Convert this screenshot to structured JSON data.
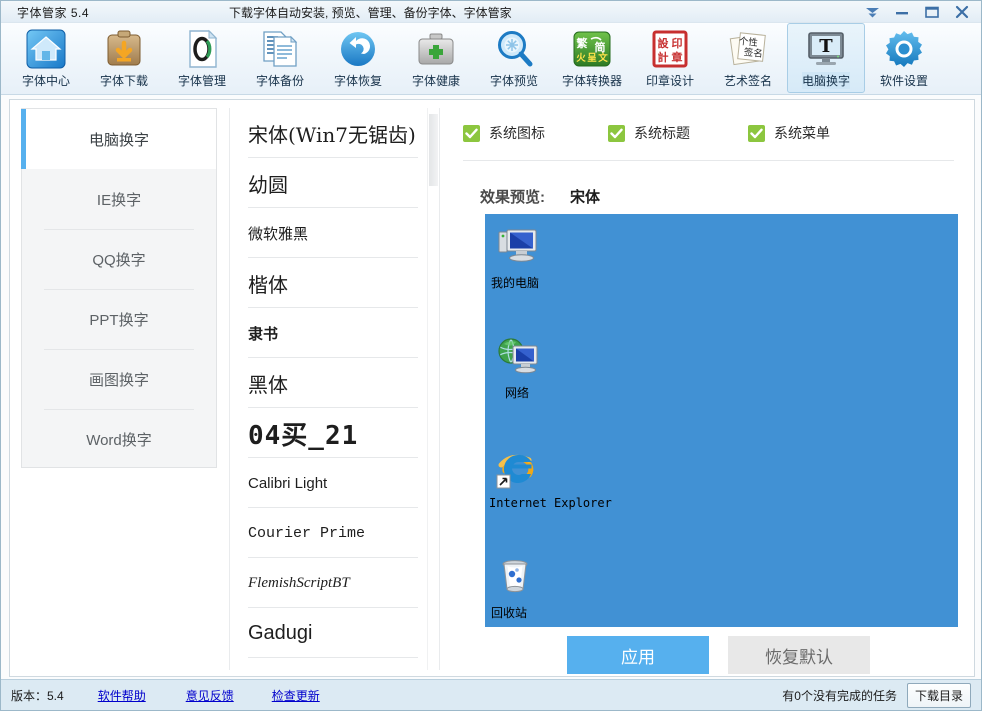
{
  "window": {
    "title": "字体管家 5.4",
    "subtitle": "下载字体自动安装, 预览、管理、备份字体、字体管家",
    "controls": [
      {
        "name": "tray-collapse",
        "icon": "chevron-down-icon"
      },
      {
        "name": "minimize",
        "icon": "minimize-icon"
      },
      {
        "name": "maximize",
        "icon": "maximize-icon"
      },
      {
        "name": "close",
        "icon": "close-icon"
      }
    ]
  },
  "toolbar": {
    "items": [
      {
        "label": "字体中心",
        "icon": "home-icon",
        "active": false
      },
      {
        "label": "字体下载",
        "icon": "download-clipboard-icon",
        "active": false
      },
      {
        "label": "字体管理",
        "icon": "document-o-icon",
        "active": false
      },
      {
        "label": "字体备份",
        "icon": "documents-copy-icon",
        "active": false
      },
      {
        "label": "字体恢复",
        "icon": "undo-circle-icon",
        "active": false
      },
      {
        "label": "字体健康",
        "icon": "medical-kit-icon",
        "active": false
      },
      {
        "label": "字体预览",
        "icon": "magnifier-icon",
        "active": false
      },
      {
        "label": "字体转换器",
        "icon": "traditional-simplified-icon",
        "active": false
      },
      {
        "label": "印章设计",
        "icon": "red-seal-icon",
        "active": false
      },
      {
        "label": "艺术签名",
        "icon": "signature-papers-icon",
        "active": false
      },
      {
        "label": "电脑换字",
        "icon": "monitor-text-icon",
        "active": true
      },
      {
        "label": "软件设置",
        "icon": "gear-icon",
        "active": false
      }
    ]
  },
  "sidebar": {
    "items": [
      {
        "label": "电脑换字",
        "active": true
      },
      {
        "label": "IE换字",
        "active": false
      },
      {
        "label": "QQ换字",
        "active": false
      },
      {
        "label": "PPT换字",
        "active": false
      },
      {
        "label": "画图换字",
        "active": false
      },
      {
        "label": "Word换字",
        "active": false
      }
    ]
  },
  "fontlist": {
    "items": [
      {
        "label": "宋体(Win7无锯齿)",
        "style": "f-serif"
      },
      {
        "label": "幼圆",
        "style": "f-sans"
      },
      {
        "label": "微软雅黑",
        "style": "f-sans f-small"
      },
      {
        "label": "楷体",
        "style": "f-libserif"
      },
      {
        "label": "隶书",
        "style": "f-sans f-bold f-small"
      },
      {
        "label": "黑体",
        "style": "f-sans"
      },
      {
        "label": "04买_21",
        "style": "f-pixel"
      },
      {
        "label": "Calibri Light",
        "style": "f-libsans f-small"
      },
      {
        "label": "Courier Prime",
        "style": "f-libmono f-small"
      },
      {
        "label": "FlemishScriptBT",
        "style": "f-script"
      },
      {
        "label": "Gadugi",
        "style": "f-libsans"
      }
    ]
  },
  "options": {
    "checkboxes": [
      {
        "label": "系统图标",
        "checked": true
      },
      {
        "label": "系统标题",
        "checked": true
      },
      {
        "label": "系统菜单",
        "checked": true
      }
    ]
  },
  "preview": {
    "label": "效果预览:",
    "font_name": "宋体",
    "background_color": "#4191d4",
    "desktop_icons": [
      {
        "label": "我的电脑",
        "icon": "my-computer-icon"
      },
      {
        "label": "网络",
        "icon": "network-globe-icon"
      },
      {
        "label": "Internet Explorer",
        "icon": "internet-explorer-icon"
      },
      {
        "label": "回收站",
        "icon": "recycle-bin-icon"
      }
    ]
  },
  "actions": {
    "apply_label": "应用",
    "reset_label": "恢复默认",
    "accent_color": "#56b0ee"
  },
  "statusbar": {
    "version": "版本：5.4",
    "links": [
      "软件帮助",
      "意见反馈",
      "检查更新"
    ],
    "tasks": "有0个没有完成的任务",
    "download_dir_label": "下载目录"
  }
}
